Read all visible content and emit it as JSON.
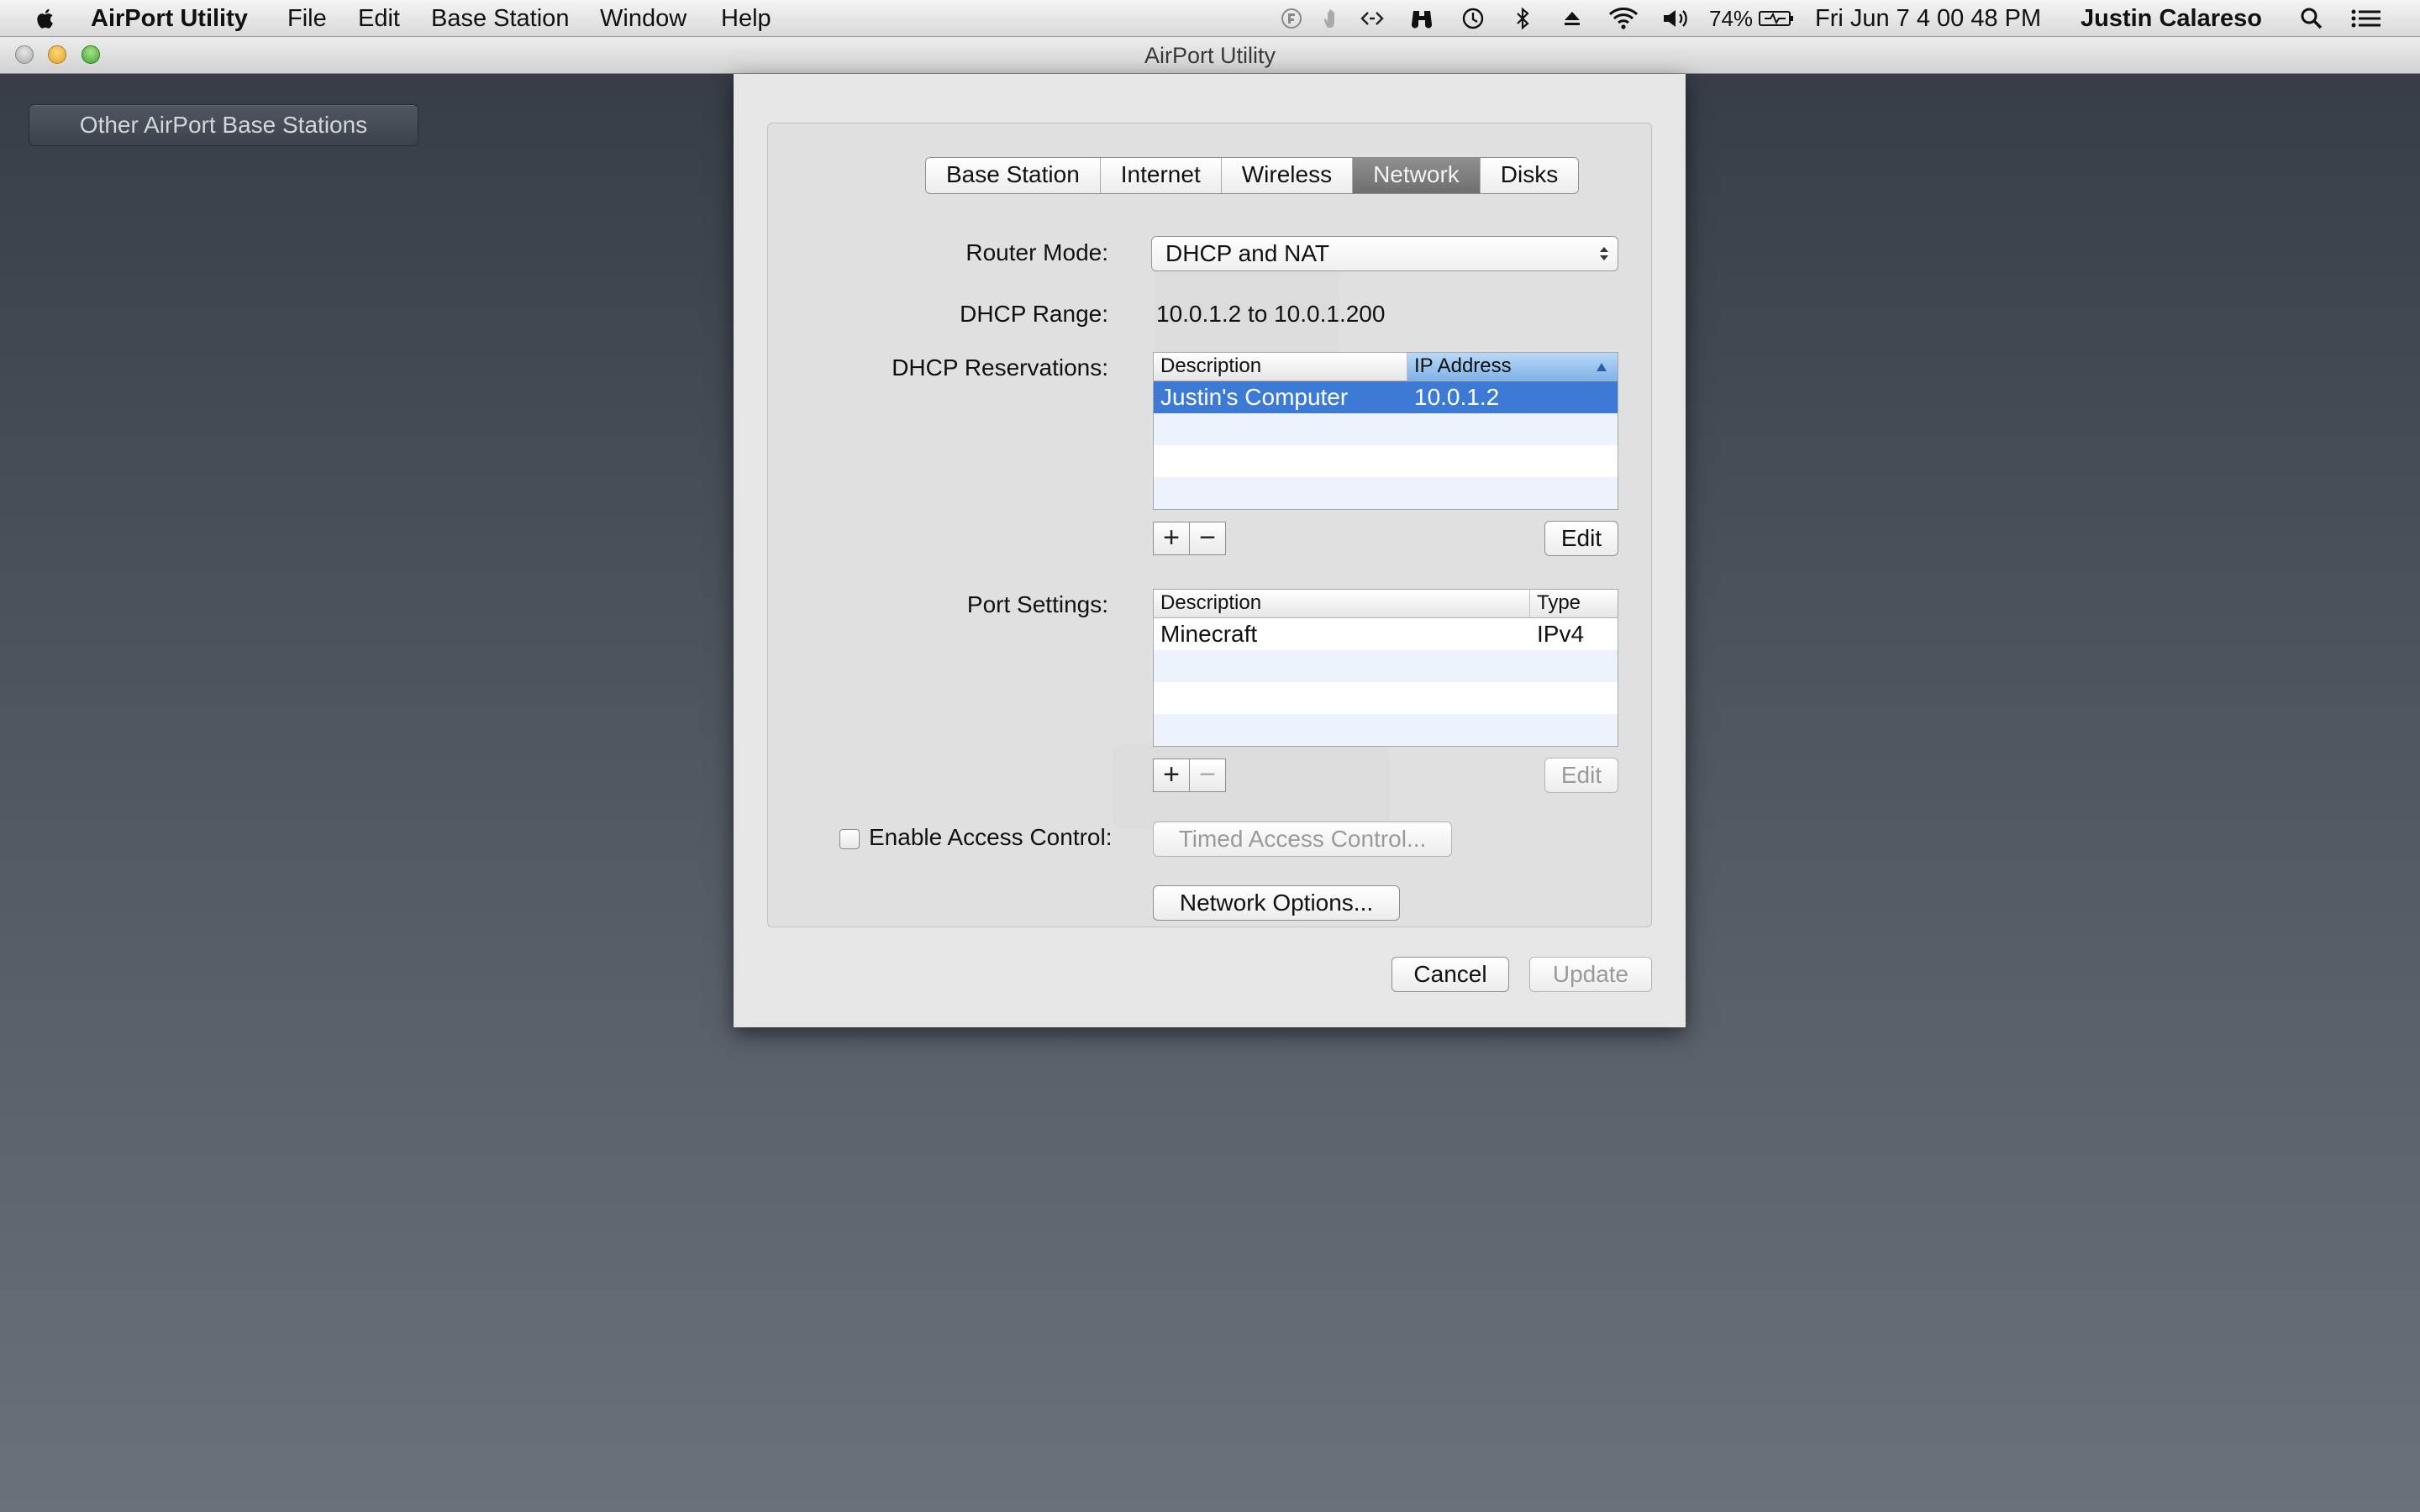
{
  "menubar": {
    "app_name": "AirPort Utility",
    "menus": [
      "File",
      "Edit",
      "Base Station",
      "Window",
      "Help"
    ],
    "battery": "74%",
    "clock": "Fri Jun 7  4 00 48 PM",
    "user": "Justin Calareso"
  },
  "window": {
    "title": "AirPort Utility"
  },
  "sidebar": {
    "other_stations_label": "Other AirPort Base Stations"
  },
  "tabs": [
    {
      "label": "Base Station",
      "selected": false
    },
    {
      "label": "Internet",
      "selected": false
    },
    {
      "label": "Wireless",
      "selected": false
    },
    {
      "label": "Network",
      "selected": true
    },
    {
      "label": "Disks",
      "selected": false
    }
  ],
  "network": {
    "router_mode_label": "Router Mode:",
    "router_mode_value": "DHCP and NAT",
    "dhcp_range_label": "DHCP Range:",
    "dhcp_range_value": "10.0.1.2 to 10.0.1.200",
    "dhcp_reservations_label": "DHCP Reservations:",
    "dhcp_table": {
      "col_description": "Description",
      "col_ip": "IP Address",
      "rows": [
        {
          "description": "Justin's Computer",
          "ip": "10.0.1.2",
          "selected": true
        }
      ]
    },
    "add_symbol": "+",
    "remove_symbol": "−",
    "edit_label": "Edit",
    "port_settings_label": "Port Settings:",
    "port_table": {
      "col_description": "Description",
      "col_type": "Type",
      "rows": [
        {
          "description": "Minecraft",
          "type": "IPv4"
        }
      ]
    },
    "access_control_label": "Enable Access Control:",
    "access_control_checked": false,
    "timed_access_label": "Timed Access Control...",
    "network_options_label": "Network Options..."
  },
  "footer": {
    "cancel_label": "Cancel",
    "update_label": "Update"
  },
  "colors": {
    "selection": "#3d7ad6",
    "sorted_header": "#7fb3e8",
    "desktop_top": "#343b45",
    "desktop_bottom": "#6a717b"
  }
}
